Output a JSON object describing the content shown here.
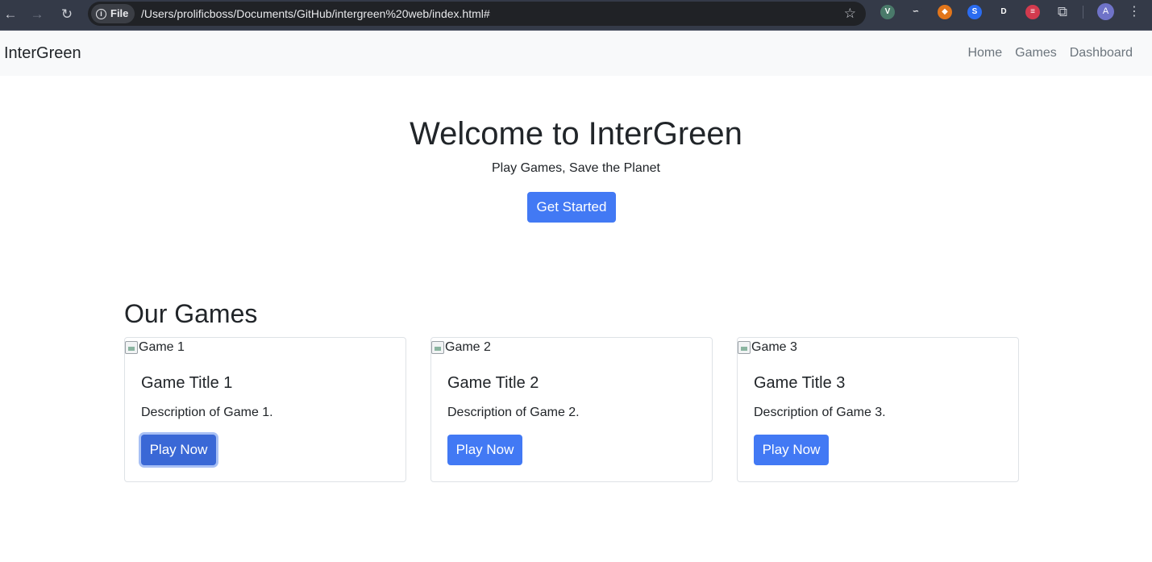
{
  "browser": {
    "url_scheme_label": "File",
    "url": "/Users/prolificboss/Documents/GitHub/intergreen%20web/index.html#",
    "profile_initial": "A",
    "extensions": [
      {
        "icon": "vue-devtools-icon",
        "glyph": "V",
        "color": "#4a7a6a"
      },
      {
        "icon": "loop-extension-icon",
        "glyph": "∽",
        "color": "#343a48"
      },
      {
        "icon": "metamask-fox-icon",
        "glyph": "◆",
        "color": "#e2761b"
      },
      {
        "icon": "blue-coin-extension-icon",
        "glyph": "S",
        "color": "#2b6cf0"
      },
      {
        "icon": "purple-d-extension-icon",
        "glyph": "D",
        "color": "#343a48"
      },
      {
        "icon": "striped-globe-extension-icon",
        "glyph": "≡",
        "color": "#d23a4e"
      }
    ]
  },
  "navbar": {
    "brand": "InterGreen",
    "links": [
      "Home",
      "Games",
      "Dashboard"
    ]
  },
  "hero": {
    "title": "Welcome to InterGreen",
    "subtitle": "Play Games, Save the Planet",
    "cta_label": "Get Started",
    "accent_color": "#4279f4"
  },
  "games": {
    "section_title": "Our Games",
    "cards": [
      {
        "image_alt": "Game 1",
        "title": "Game Title 1",
        "description": "Description of Game 1.",
        "button_label": "Play Now"
      },
      {
        "image_alt": "Game 2",
        "title": "Game Title 2",
        "description": "Description of Game 2.",
        "button_label": "Play Now"
      },
      {
        "image_alt": "Game 3",
        "title": "Game Title 3",
        "description": "Description of Game 3.",
        "button_label": "Play Now"
      }
    ]
  }
}
